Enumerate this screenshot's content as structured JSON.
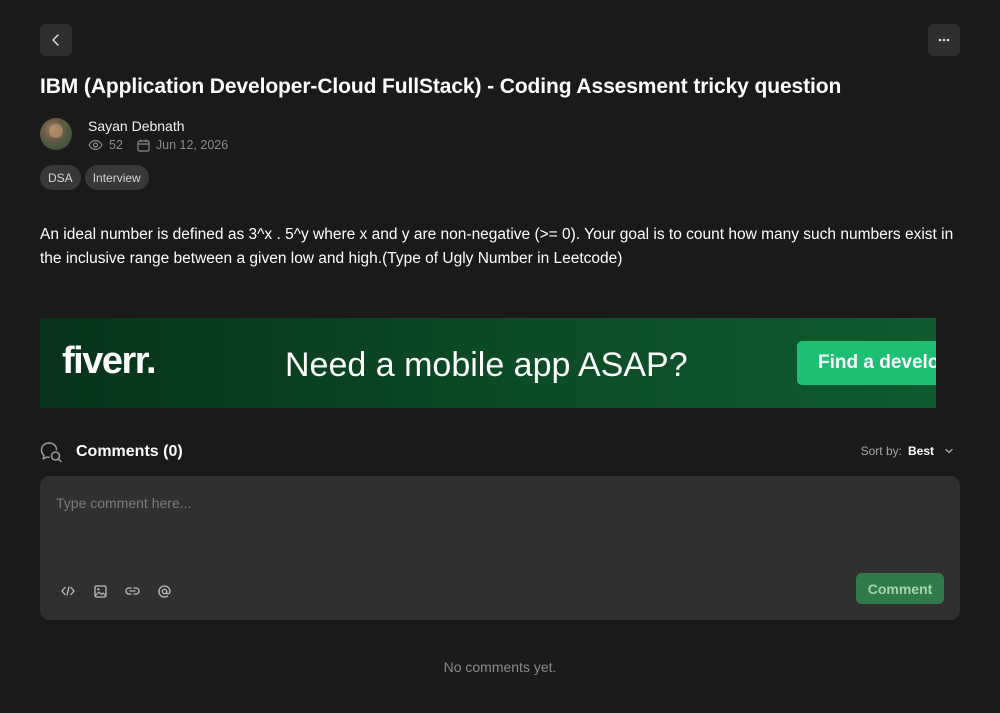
{
  "post": {
    "title": "IBM (Application Developer-Cloud FullStack) - Coding Assesment tricky question",
    "author": "Sayan Debnath",
    "views": "52",
    "date": "Jun 12, 2026",
    "tags": [
      "DSA",
      "Interview"
    ],
    "body": "An ideal number is defined as 3^x . 5^y where x and y are non-negative (>= 0). Your goal is to count how many such numbers exist in the inclusive range between a given low and high.(Type of Ugly Number in Leetcode)"
  },
  "ad": {
    "logo": "fiverr.",
    "headline": "Need a mobile app ASAP?",
    "cta": "Find a develop"
  },
  "comments": {
    "title": "Comments (0)",
    "sort_label": "Sort by:",
    "sort_value": "Best",
    "placeholder": "Type comment here...",
    "submit_label": "Comment",
    "empty_text": "No comments yet."
  },
  "colors": {
    "background": "#1a1a1a",
    "surface": "#303030",
    "accent": "#2f7b4b",
    "fiverr_green": "#1dbf73"
  },
  "icons": [
    "chevron-left-icon",
    "more-horizontal-icon",
    "eye-icon",
    "calendar-icon",
    "comments-icon",
    "chevron-down-icon",
    "code-icon",
    "image-icon",
    "link-icon",
    "at-icon"
  ]
}
